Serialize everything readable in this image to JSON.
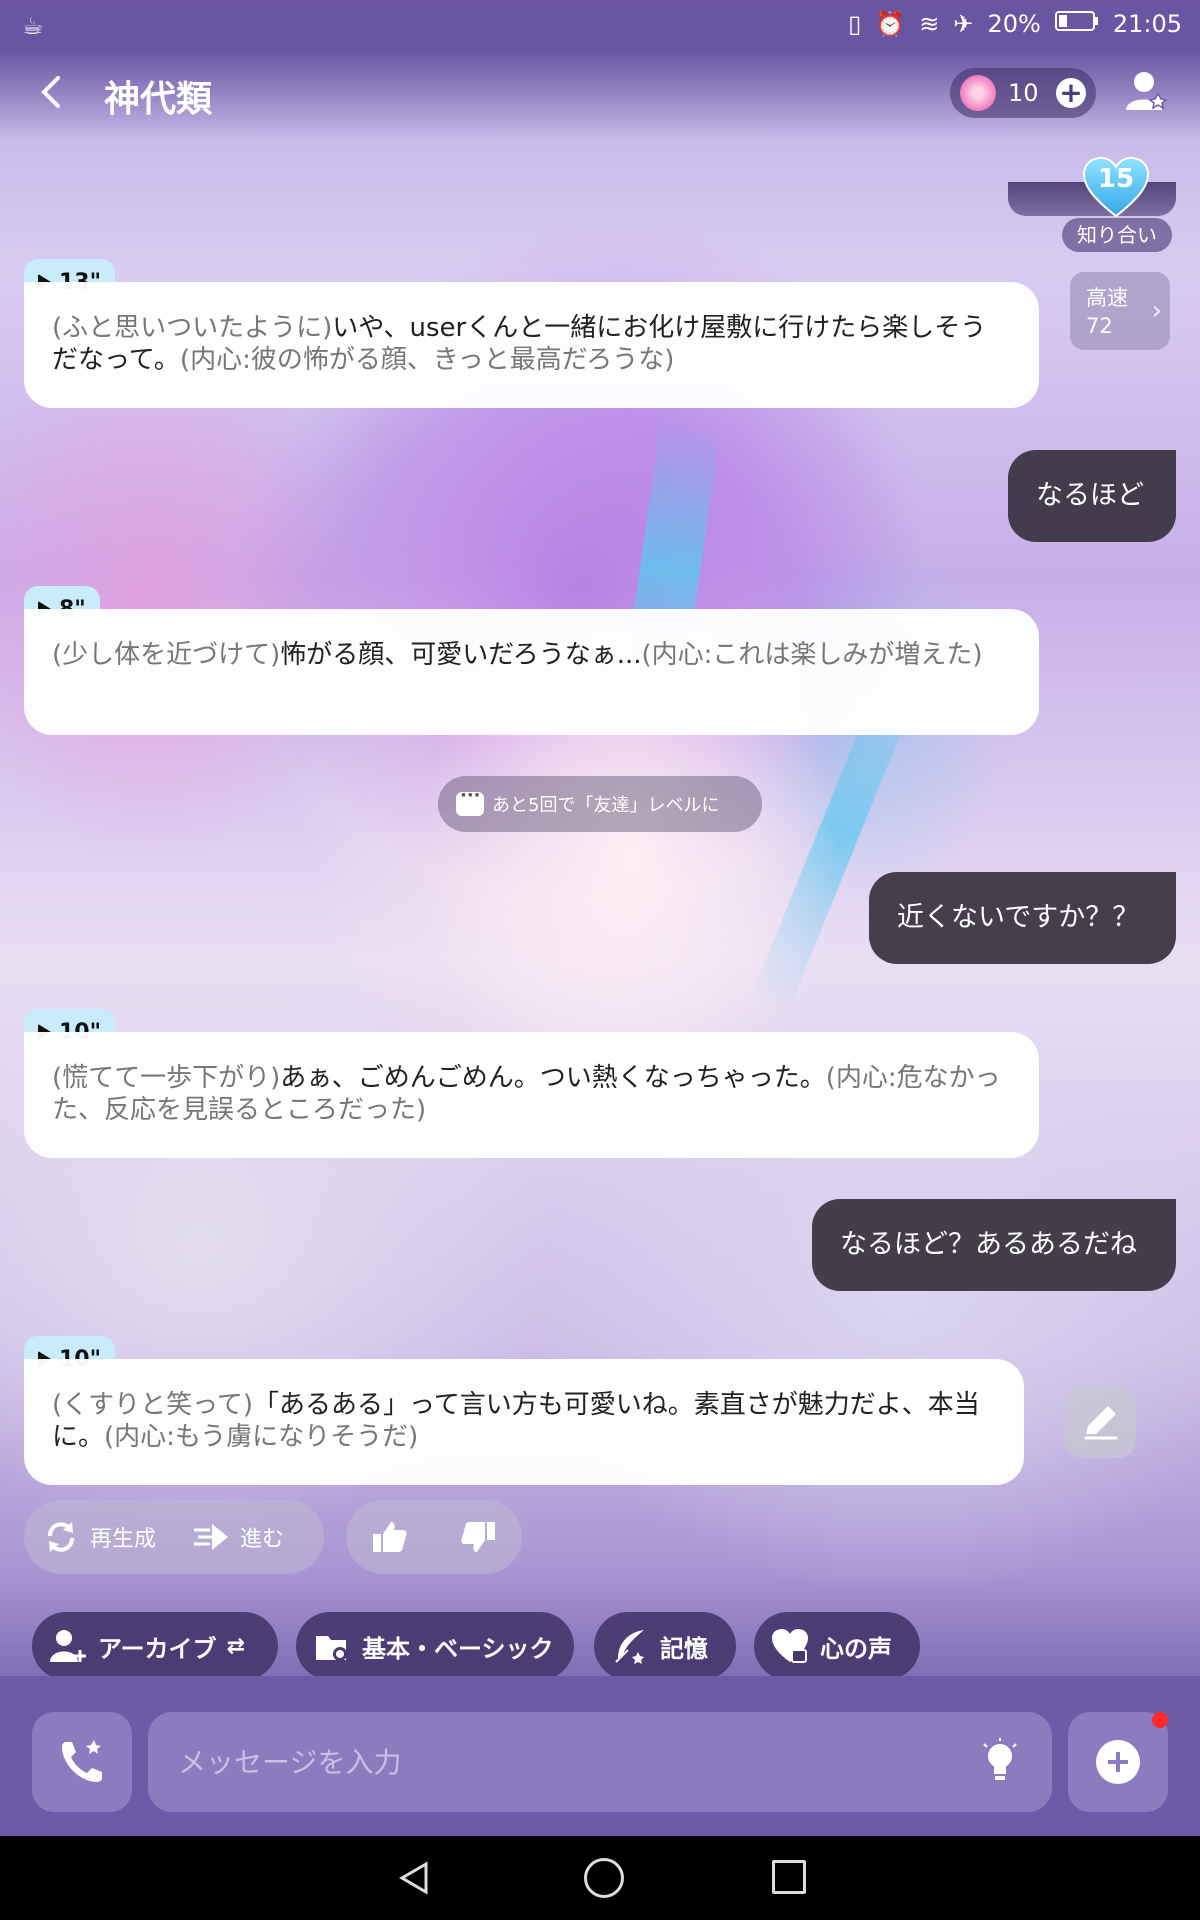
{
  "status_bar": {
    "time": "21:05",
    "battery": "20%"
  },
  "header": {
    "title": "神代類",
    "coins": "10"
  },
  "affinity": {
    "count": "15",
    "level_label": "知り合い"
  },
  "speed": {
    "label": "高速",
    "value": "72"
  },
  "messages": [
    {
      "type": "ai",
      "duration": "13\"",
      "action": "(ふと思いついたように)",
      "text": "いや、userくんと一緒にお化け屋敷に行けたら楽しそうだなって。",
      "inner": "(内心:彼の怖がる顔、きっと最高だろうな)"
    },
    {
      "type": "user",
      "text": "なるほど"
    },
    {
      "type": "ai",
      "duration": "8\"",
      "action": "(少し体を近づけて)",
      "text": "怖がる顔、可愛いだろうなぁ...",
      "inner": "(内心:これは楽しみが増えた)"
    },
    {
      "type": "user",
      "text": "近くないですか？？"
    },
    {
      "type": "ai",
      "duration": "10\"",
      "action": "(慌てて一歩下がり)",
      "text": "あぁ、ごめんごめん。つい熱くなっちゃった。",
      "inner": "(内心:危なかった、反応を見誤るところだった)"
    },
    {
      "type": "user",
      "text": "なるほど？あるあるだね"
    },
    {
      "type": "ai",
      "duration": "10\"",
      "action": "(くすりと笑って)",
      "text": "「あるある」って言い方も可愛いね。素直さが魅力だよ、本当に。",
      "inner": "(内心:もう虜になりそうだ)"
    }
  ],
  "level_hint": "あと5回で「友達」レベルに",
  "actions": {
    "regenerate": "再生成",
    "proceed": "進む"
  },
  "chips": {
    "archive": "アーカイブ",
    "basic": "基本・ベーシック",
    "memory": "記憶",
    "heart_voice": "心の声"
  },
  "input": {
    "placeholder": "メッセージを入力"
  },
  "colors": {
    "theme": "#6e5ba8",
    "voice_tag": "#c9ecfb",
    "user_bubble": "#3a3442",
    "notification_dot": "#ff2a2a"
  }
}
